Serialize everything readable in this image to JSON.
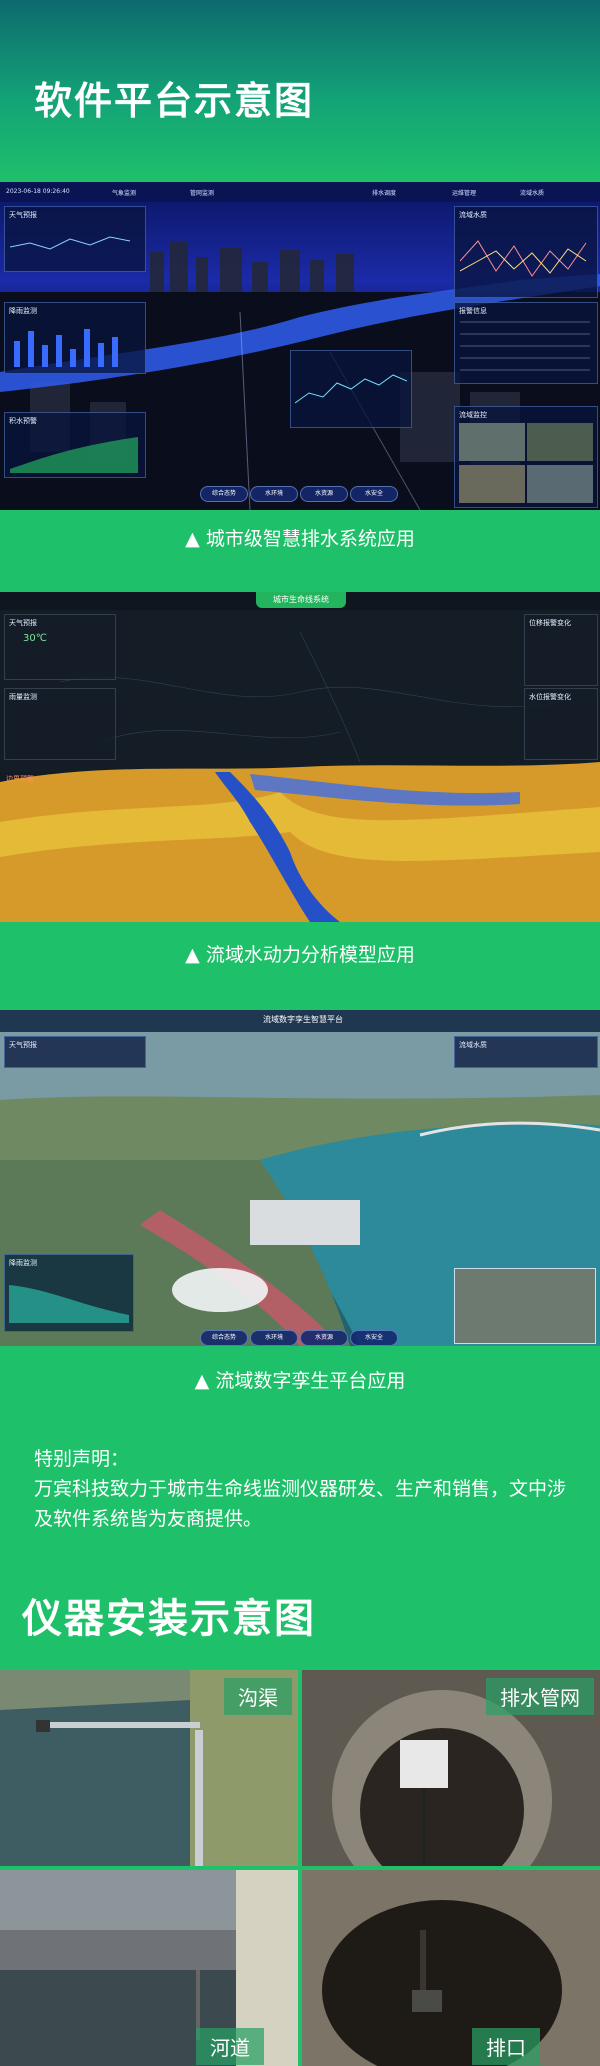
{
  "header": {
    "title": "软件平台示意图"
  },
  "platform": {
    "screens": [
      {
        "caption": "▲ 城市级智慧排水系统应用",
        "topbar": [
          "2023-06-18 09:26:40",
          "气象监测",
          "管网监测",
          "排水调度",
          "运维管理",
          "流域水质"
        ],
        "panels": {
          "weather": "天气预报",
          "rain": "降雨监测",
          "forecast": "积水预警",
          "water": "流域水质",
          "alarm": "报警信息",
          "video": "流域监控"
        },
        "tabs": [
          "综合态势",
          "水环境",
          "水资源",
          "水安全"
        ]
      },
      {
        "caption": "▲ 流域水动力分析模型应用",
        "topbar_title": "城市生命线系统",
        "panels": {
          "weather": "天气预报",
          "temp": "30℃",
          "rain": "雨量监测",
          "level": "位移报警变化",
          "flow": "水位报警变化",
          "boundary": "边界预警"
        }
      },
      {
        "caption": "▲ 流域数字孪生平台应用",
        "topbar_title": "流域数字孪生智慧平台",
        "panels": {
          "weather": "天气预报",
          "water": "流域水质",
          "rain": "降雨监测"
        },
        "tabs": [
          "综合态势",
          "水环境",
          "水资源",
          "水安全"
        ]
      }
    ]
  },
  "notice": {
    "heading": "特别声明：",
    "body": "万宾科技致力于城市生命线监测仪器研发、生产和销售，文中涉及软件系统皆为友商提供。"
  },
  "install": {
    "title": "仪器安装示意图",
    "cells": [
      "沟渠",
      "排水管网",
      "河道",
      "排口"
    ]
  },
  "colors": {
    "brand_green": "#1fc06a",
    "header_teal": "#0e6a6e",
    "screen_blue": "#1b2aa8"
  }
}
